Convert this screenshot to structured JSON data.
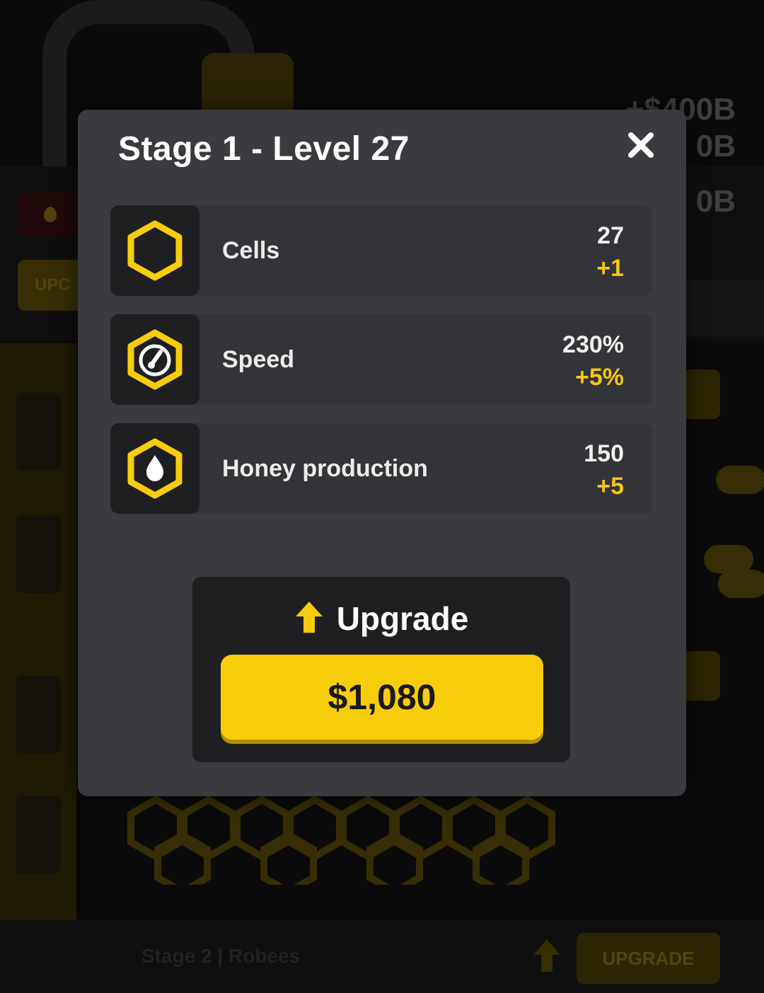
{
  "background": {
    "money_lines": [
      "+$400B",
      "0B",
      "0B"
    ],
    "left_upgrade_text": "UPC",
    "bottom_stage_label": "Stage 2 | Robees",
    "bottom_upgrade_label": "UPGRADE"
  },
  "modal": {
    "title": "Stage 1 - Level 27",
    "close_icon": "close-icon",
    "stats": [
      {
        "icon": "hexagon-icon",
        "label": "Cells",
        "value": "27",
        "delta": "+1"
      },
      {
        "icon": "speedometer-icon",
        "label": "Speed",
        "value": "230%",
        "delta": "+5%"
      },
      {
        "icon": "honey-drop-icon",
        "label": "Honey production",
        "value": "150",
        "delta": "+5"
      }
    ],
    "upgrade": {
      "label": "Upgrade",
      "icon": "arrow-up-icon",
      "price": "$1,080"
    }
  },
  "colors": {
    "accent_yellow": "#f7cc0a",
    "modal_bg": "#3a3b3e",
    "row_bg": "#333437",
    "icon_box_bg": "#1f1f21"
  }
}
